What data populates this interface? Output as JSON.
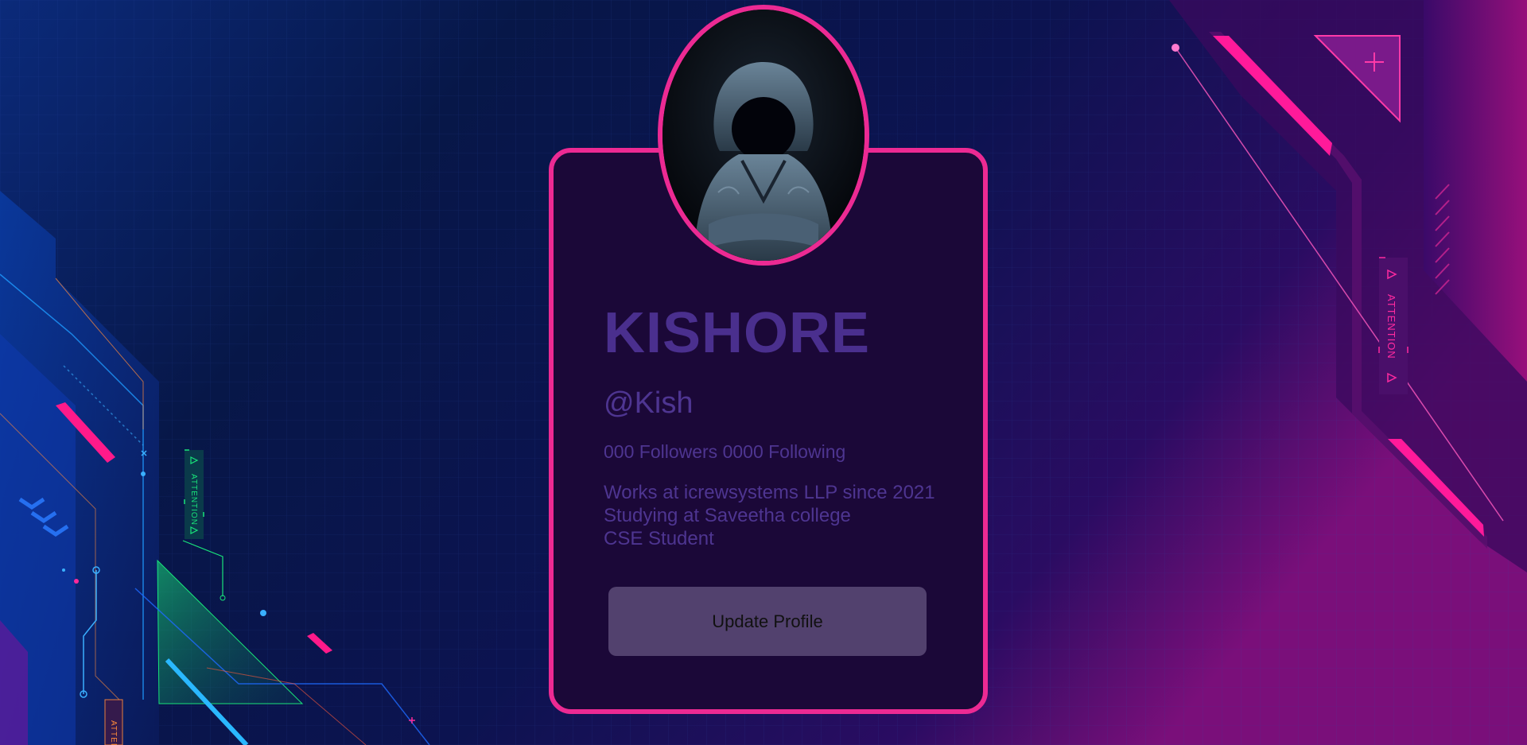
{
  "profile": {
    "name": "KISHORE",
    "handle": "@Kish",
    "stats": "000 Followers 0000 Following",
    "bio": [
      "Works at icrewsystems LLP since 2021",
      "Studying at Saveetha college",
      "CSE Student"
    ]
  },
  "actions": {
    "update_label": "Update Profile"
  },
  "decor": {
    "attention_left": "ATTENTION",
    "attention_right": "ATTENTION",
    "attention_bottom": "ATTEN"
  },
  "colors": {
    "accent": "#ec2a93",
    "card_bg": "#1b0838",
    "text": "#4e3591",
    "button": "#52416e",
    "neon_green": "#19e37a",
    "neon_blue": "#1e9bff"
  },
  "icons": {
    "avatar": "hooded-figure-avatar"
  }
}
